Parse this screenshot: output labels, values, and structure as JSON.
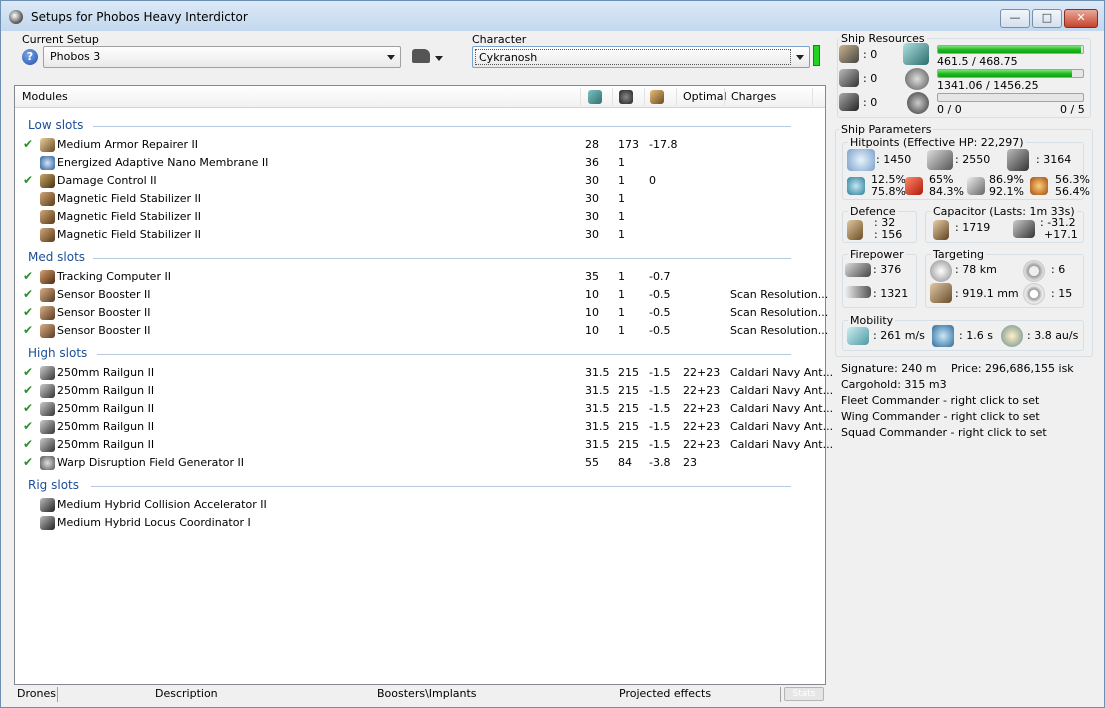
{
  "window": {
    "title": "Setups for Phobos Heavy Interdictor"
  },
  "setup": {
    "label": "Current Setup",
    "value": "Phobos 3"
  },
  "character": {
    "label": "Character",
    "value": "Cykranosh"
  },
  "modules": {
    "columns": {
      "name": "Modules",
      "optimal": "Optimal",
      "charges": "Charges"
    },
    "sections": [
      {
        "title": "Low slots",
        "rows": [
          {
            "checked": true,
            "icon": "armor-repairer-icon",
            "name": "Medium Armor Repairer II",
            "c1": "28",
            "c2": "173",
            "c3": "-17.8",
            "optimal": "",
            "charges": ""
          },
          {
            "checked": false,
            "icon": "membrane-icon",
            "name": "Energized Adaptive Nano Membrane II",
            "c1": "36",
            "c2": "1",
            "c3": "",
            "optimal": "",
            "charges": ""
          },
          {
            "checked": true,
            "icon": "damage-control-icon",
            "name": "Damage Control II",
            "c1": "30",
            "c2": "1",
            "c3": "0",
            "optimal": "",
            "charges": ""
          },
          {
            "checked": false,
            "icon": "magstab-icon",
            "name": "Magnetic Field Stabilizer II",
            "c1": "30",
            "c2": "1",
            "c3": "",
            "optimal": "",
            "charges": ""
          },
          {
            "checked": false,
            "icon": "magstab-icon",
            "name": "Magnetic Field Stabilizer II",
            "c1": "30",
            "c2": "1",
            "c3": "",
            "optimal": "",
            "charges": ""
          },
          {
            "checked": false,
            "icon": "magstab-icon",
            "name": "Magnetic Field Stabilizer II",
            "c1": "30",
            "c2": "1",
            "c3": "",
            "optimal": "",
            "charges": ""
          }
        ]
      },
      {
        "title": "Med slots",
        "rows": [
          {
            "checked": true,
            "icon": "tracking-computer-icon",
            "name": "Tracking Computer II",
            "c1": "35",
            "c2": "1",
            "c3": "-0.7",
            "optimal": "",
            "charges": ""
          },
          {
            "checked": true,
            "icon": "sensor-booster-icon",
            "name": "Sensor Booster II",
            "c1": "10",
            "c2": "1",
            "c3": "-0.5",
            "optimal": "",
            "charges": "Scan Resolution..."
          },
          {
            "checked": true,
            "icon": "sensor-booster-icon",
            "name": "Sensor Booster II",
            "c1": "10",
            "c2": "1",
            "c3": "-0.5",
            "optimal": "",
            "charges": "Scan Resolution..."
          },
          {
            "checked": true,
            "icon": "sensor-booster-icon",
            "name": "Sensor Booster II",
            "c1": "10",
            "c2": "1",
            "c3": "-0.5",
            "optimal": "",
            "charges": "Scan Resolution..."
          }
        ]
      },
      {
        "title": "High slots",
        "rows": [
          {
            "checked": true,
            "icon": "railgun-icon",
            "name": "250mm Railgun II",
            "c1": "31.5",
            "c2": "215",
            "c3": "-1.5",
            "optimal": "22+23",
            "charges": "Caldari Navy Ant..."
          },
          {
            "checked": true,
            "icon": "railgun-icon",
            "name": "250mm Railgun II",
            "c1": "31.5",
            "c2": "215",
            "c3": "-1.5",
            "optimal": "22+23",
            "charges": "Caldari Navy Ant..."
          },
          {
            "checked": true,
            "icon": "railgun-icon",
            "name": "250mm Railgun II",
            "c1": "31.5",
            "c2": "215",
            "c3": "-1.5",
            "optimal": "22+23",
            "charges": "Caldari Navy Ant..."
          },
          {
            "checked": true,
            "icon": "railgun-icon",
            "name": "250mm Railgun II",
            "c1": "31.5",
            "c2": "215",
            "c3": "-1.5",
            "optimal": "22+23",
            "charges": "Caldari Navy Ant..."
          },
          {
            "checked": true,
            "icon": "railgun-icon",
            "name": "250mm Railgun II",
            "c1": "31.5",
            "c2": "215",
            "c3": "-1.5",
            "optimal": "22+23",
            "charges": "Caldari Navy Ant..."
          },
          {
            "checked": true,
            "icon": "warp-disruption-icon",
            "name": "Warp Disruption Field Generator II",
            "c1": "55",
            "c2": "84",
            "c3": "-3.8",
            "optimal": "23",
            "charges": ""
          }
        ]
      },
      {
        "title": "Rig slots",
        "rows": [
          {
            "checked": false,
            "icon": "rig-icon",
            "name": "Medium Hybrid Collision Accelerator II",
            "c1": "",
            "c2": "",
            "c3": "",
            "optimal": "",
            "charges": ""
          },
          {
            "checked": false,
            "icon": "rig-icon",
            "name": "Medium Hybrid Locus Coordinator I",
            "c1": "",
            "c2": "",
            "c3": "",
            "optimal": "",
            "charges": ""
          }
        ]
      }
    ]
  },
  "bottom_tabs": {
    "drones": "Drones",
    "description": "Description",
    "boosters": "Boosters\\Implants",
    "projected": "Projected effects",
    "stats": "Stats"
  },
  "resources": {
    "title": "Ship Resources",
    "turret_hardpoints": ": 0",
    "launcher_hardpoints": ": 0",
    "calibration": ": 0",
    "cpu": {
      "text": "461.5 / 468.75",
      "fraction": 0.985
    },
    "powergrid": {
      "text": "1341.06 / 1456.25",
      "fraction": 0.921
    },
    "drone_bay": {
      "left": "0 / 0",
      "right": "0 / 5",
      "fraction": 0
    }
  },
  "params": {
    "title": "Ship Parameters",
    "hitpoints": {
      "title": "Hitpoints (Effective HP: 22,297)",
      "shield": ": 1450",
      "armor": ": 2550",
      "structure": ": 3164",
      "em": [
        "12.5%",
        "75.8%"
      ],
      "thermal": [
        "65%",
        "84.3%"
      ],
      "kinetic": [
        "86.9%",
        "92.1%"
      ],
      "explosive": [
        "56.3%",
        "56.4%"
      ]
    },
    "defence": {
      "title": "Defence",
      "a": ": 32",
      "b": ": 156"
    },
    "capacitor": {
      "title": "Capacitor (Lasts: 1m 33s)",
      "amount": ": 1719",
      "delta": ": -31.2",
      "delta2": "+17.1"
    },
    "firepower": {
      "title": "Firepower",
      "dps": ": 376",
      "volley": ": 1321"
    },
    "targeting": {
      "title": "Targeting",
      "range": ": 78 km",
      "targets": ": 6",
      "scanres": ": 919.1 mm",
      "sensor": ": 15"
    },
    "mobility": {
      "title": "Mobility",
      "speed": ": 261 m/s",
      "align": ": 1.6 s",
      "warp": ": 3.8 au/s"
    },
    "signature": "Signature: 240 m",
    "price": "Price: 296,686,155 isk",
    "cargohold": "Cargohold: 315 m3",
    "fleet": "Fleet Commander - right click to set",
    "wing": "Wing Commander - right click to set",
    "squad": "Squad Commander - right click to set"
  }
}
